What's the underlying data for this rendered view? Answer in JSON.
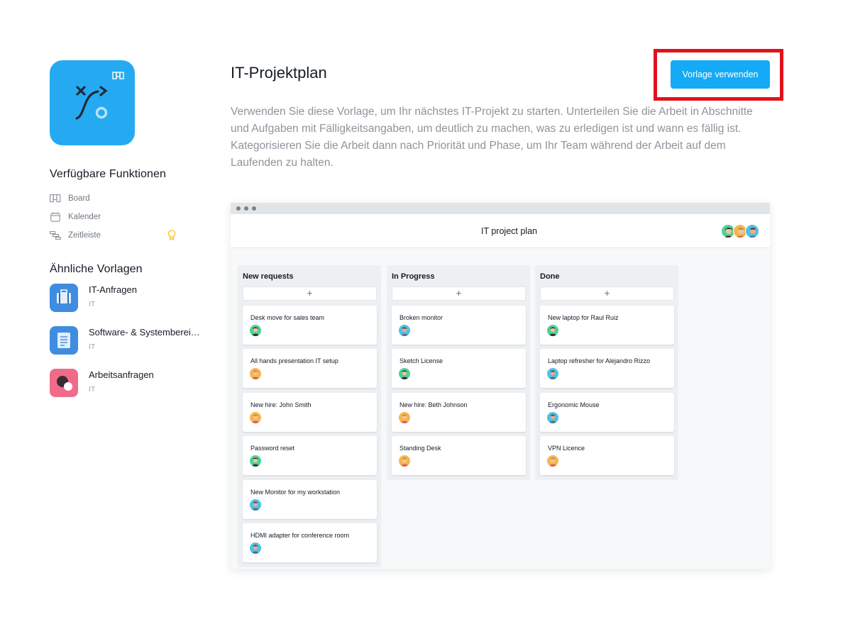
{
  "template": {
    "title": "IT-Projektplan",
    "use_button_label": "Vorlage verwenden",
    "description": "Verwenden Sie diese Vorlage, um Ihr nächstes IT-Projekt zu starten. Unterteilen Sie die Arbeit in Abschnitte und Aufgaben mit Fälligkeitsangaben, um deutlich zu machen, was zu erledigen ist und wann es fällig ist. Kategorisieren Sie die Arbeit dann nach Priorität und Phase, um Ihr Team während der Arbeit auf dem Laufenden zu halten.",
    "icon": "project-plan-icon",
    "accent_color": "#25aaf1"
  },
  "features": {
    "title": "Verfügbare Funktionen",
    "items": [
      {
        "label": "Board",
        "icon": "board-icon"
      },
      {
        "label": "Kalender",
        "icon": "calendar-icon"
      },
      {
        "label": "Zeitleiste",
        "icon": "timeline-icon",
        "premium_icon": "premium-badge-icon"
      }
    ]
  },
  "similar": {
    "title": "Ähnliche Vorlagen",
    "items": [
      {
        "name": "IT-Anfragen",
        "category": "IT",
        "icon": "briefcase-icon",
        "color": "#3f8de0"
      },
      {
        "name": "Software- & Systembereitstellung",
        "category": "IT",
        "icon": "document-list-icon",
        "color": "#3f8de0"
      },
      {
        "name": "Arbeitsanfragen",
        "category": "IT",
        "icon": "speech-bubbles-icon",
        "color": "#f06a8a"
      }
    ]
  },
  "preview": {
    "title": "IT project plan",
    "add_symbol": "+",
    "columns": [
      {
        "name": "New requests",
        "cards": [
          "Desk move for sales team",
          "All hands presentation IT setup",
          "New hire: John Smith",
          "Password reset",
          "New Monitor for my workstation",
          "HDMI adapter for conference room"
        ]
      },
      {
        "name": "In Progress",
        "cards": [
          "Broken monitor",
          "Sketch License",
          "New hire: Beth Johnson",
          "Standing Desk"
        ]
      },
      {
        "name": "Done",
        "cards": [
          "New laptop for Raul Ruiz",
          "Laptop refresher for Alejandro Rizzo",
          "Ergonomic Mouse",
          "VPN Licence"
        ]
      }
    ]
  }
}
